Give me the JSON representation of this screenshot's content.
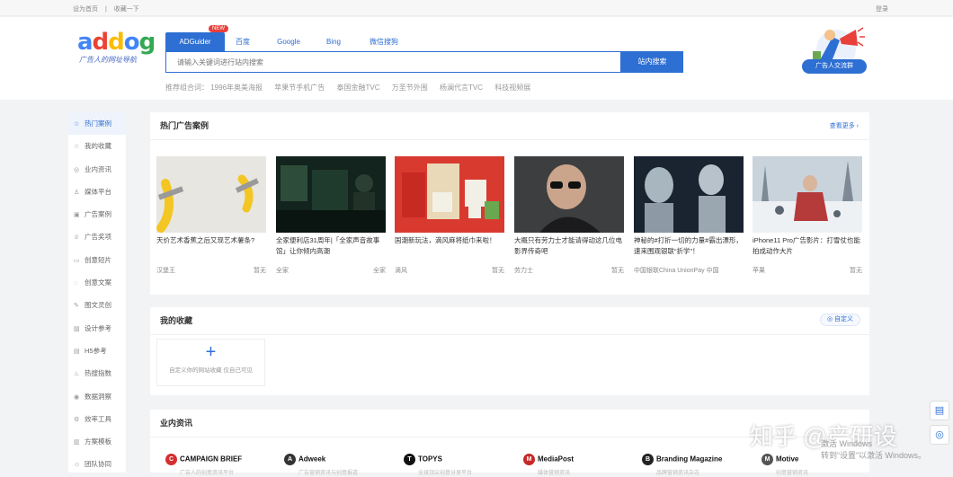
{
  "topbar": {
    "set_home": "设为首页",
    "separator": "|",
    "collect": "收藏一下",
    "login": "登录"
  },
  "logo": {
    "letters": [
      "a",
      "d",
      "d",
      "o",
      "g"
    ],
    "slogan": "广告人的网址导航"
  },
  "search": {
    "tabs": [
      "ADGuider",
      "百度",
      "Google",
      "Bing",
      "微信搜狗"
    ],
    "new_badge": "NEW",
    "placeholder": "请输入关键词进行站内搜索",
    "button": "站内搜索"
  },
  "recommend": {
    "label": "推荐组合词：",
    "items": [
      "1996年奥美海报",
      "苹果节手机广告",
      "泰国金融TVC",
      "万圣节外围",
      "杨澜代言TVC",
      "科技视频展"
    ]
  },
  "group_button": "广告人交流群",
  "sidebar": [
    {
      "icon": "☆",
      "label": "热门案例",
      "active": true
    },
    {
      "icon": "☆",
      "label": "我的收藏"
    },
    {
      "icon": "◎",
      "label": "业内资讯"
    },
    {
      "icon": "♙",
      "label": "媒体平台"
    },
    {
      "icon": "▣",
      "label": "广告案例"
    },
    {
      "icon": "♕",
      "label": "广告奖项"
    },
    {
      "icon": "▭",
      "label": "创意短片"
    },
    {
      "icon": "◌",
      "label": "创意文案"
    },
    {
      "icon": "✎",
      "label": "图文灵创"
    },
    {
      "icon": "▨",
      "label": "设计参考"
    },
    {
      "icon": "▤",
      "label": "H5参考"
    },
    {
      "icon": "♨",
      "label": "热搜指数"
    },
    {
      "icon": "◉",
      "label": "数据洞察"
    },
    {
      "icon": "⚙",
      "label": "效率工具"
    },
    {
      "icon": "▥",
      "label": "方案模板"
    },
    {
      "icon": "☺",
      "label": "团队协同"
    }
  ],
  "hot": {
    "title": "热门广告案例",
    "more": "查看更多 ›",
    "cards": [
      {
        "title": "天价艺术香蕉之后又现艺术薯条?",
        "author": "汉堡王",
        "tag": "暂无"
      },
      {
        "title": "全家便利店31周年|「全家声音故事馆」让你倾内高潮",
        "author": "全家",
        "tag": "全家"
      },
      {
        "title": "国潮新玩法，滴风麻将纸巾来啦！",
        "author": "滴风",
        "tag": "暂无"
      },
      {
        "title": "大概只有劳力士才能请得动这几位电影界传奇吧",
        "author": "劳力士",
        "tag": "暂无"
      },
      {
        "title": "神秘的#打折一切的力量#霸出漂形，速来围观银联“折学”！",
        "author": "中国银联China UnionPay 中国银联",
        "tag": ""
      },
      {
        "title": "iPhone11 Pro广告影片：打雪仗也能拍成动作大片",
        "author": "苹果",
        "tag": "暂无"
      }
    ]
  },
  "favorites": {
    "title": "我的收藏",
    "custom": "◎ 自定义",
    "add_symbol": "+",
    "add_hint": "自定义你的网站收藏 仅自己可见"
  },
  "news": {
    "title": "业内资讯",
    "brands": [
      {
        "name": "CAMPAIGN BRIEF",
        "sub": "广告人的创意资讯平台",
        "color": "#d32f2f"
      },
      {
        "name": "Adweek",
        "sub": "广告营销资讯与创意报道",
        "color": "#333333"
      },
      {
        "name": "TOPYS",
        "sub": "全球顶尖创意分享平台",
        "color": "#111111"
      },
      {
        "name": "MediaPost",
        "sub": "媒体营销资讯",
        "color": "#c62828"
      },
      {
        "name": "Branding Magazine",
        "sub": "品牌营销资讯杂志",
        "color": "#222222"
      },
      {
        "name": "Motive",
        "sub": "创意营销资讯",
        "color": "#555555"
      }
    ]
  },
  "watermark": "知乎 @产研设",
  "windows_activation": [
    "激活 Windows",
    "转到“设置”以激活 Windows。"
  ]
}
